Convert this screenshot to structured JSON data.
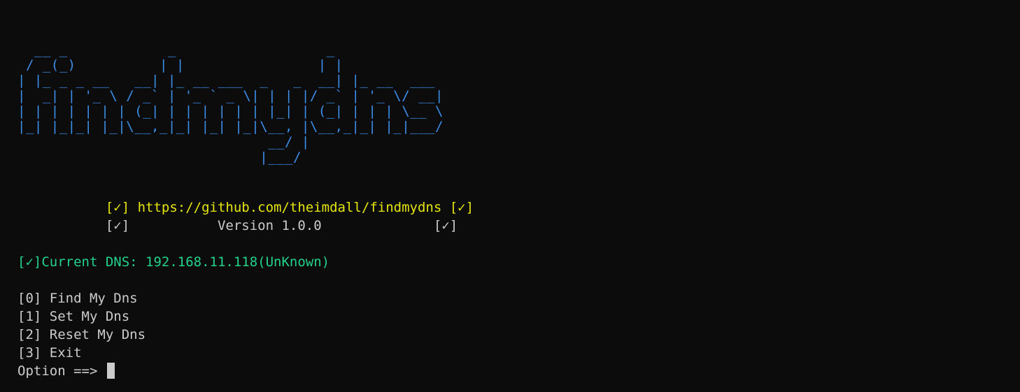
{
  "banner": {
    "ascii_lines": [
      "  __ _            _                  _",
      " / _(_)          | |                | |",
      "| |_ _ _ __   __| |_ __ ___  _   _  __| |_ __  ___",
      "|  _| | '_ \\ / _` | '_ ` _ \\| | | |/ _` | '_ \\/ __|",
      "| | | | | | | (_| | | | | | | |_| | (_| | | | \\__ \\",
      "|_| |_|_| |_|\\__,_|_| |_| |_|\\__, |\\__,_|_| |_|___/",
      "                              __/ |",
      "                             |___/"
    ],
    "url_line": "           [✓] https://github.com/theimdall/findmydns [✓]",
    "version_line": "           [✓]           Version 1.0.0              [✓]"
  },
  "status": {
    "current_dns": "[✓]Current DNS: 192.168.11.118(UnKnown)"
  },
  "menu": {
    "items": [
      "[0] Find My Dns",
      "[1] Set My Dns",
      "[2] Reset My Dns",
      "[3] Exit"
    ],
    "prompt": "Option ==> "
  },
  "colors": {
    "background": "#0c0c0c",
    "ascii": "#3b8eea",
    "url": "#e5e510",
    "status": "#23d18b",
    "text": "#cccccc"
  }
}
